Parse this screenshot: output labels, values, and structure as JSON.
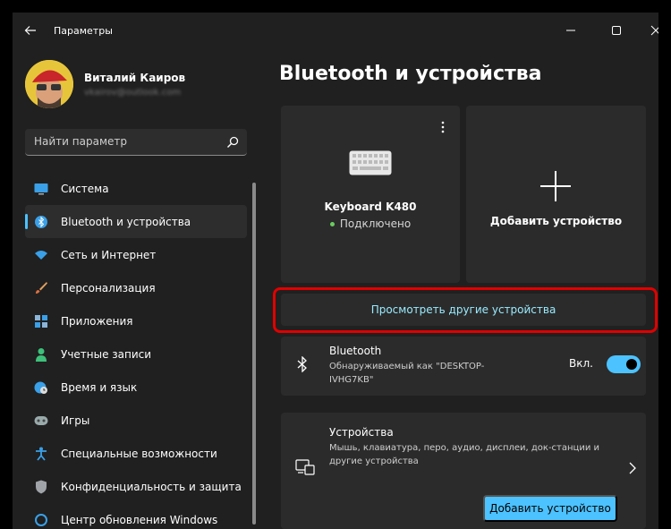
{
  "window": {
    "title": "Параметры"
  },
  "profile": {
    "name": "Виталий Каиров",
    "email": "vkairov@outlook.com"
  },
  "search": {
    "placeholder": "Найти параметр"
  },
  "sidebar": {
    "items": [
      {
        "label": "Система",
        "icon": "monitor-icon"
      },
      {
        "label": "Bluetooth и устройства",
        "icon": "bluetooth-icon",
        "active": true
      },
      {
        "label": "Сеть и Интернет",
        "icon": "wifi-icon"
      },
      {
        "label": "Персонализация",
        "icon": "brush-icon"
      },
      {
        "label": "Приложения",
        "icon": "apps-icon"
      },
      {
        "label": "Учетные записи",
        "icon": "person-icon"
      },
      {
        "label": "Время и язык",
        "icon": "globe-clock-icon"
      },
      {
        "label": "Игры",
        "icon": "gamepad-icon"
      },
      {
        "label": "Специальные возможности",
        "icon": "accessibility-icon"
      },
      {
        "label": "Конфиденциальность и защита",
        "icon": "shield-icon"
      },
      {
        "label": "Центр обновления Windows",
        "icon": "update-icon"
      }
    ]
  },
  "main": {
    "title": "Bluetooth и устройства",
    "device_card": {
      "name": "Keyboard K480",
      "status": "Подключено",
      "icon": "keyboard-icon"
    },
    "add_card": {
      "label": "Добавить устройство",
      "icon": "plus-icon"
    },
    "more_devices_label": "Просмотреть другие устройства",
    "bluetooth": {
      "title": "Bluetooth",
      "description": "Обнаруживаемый как \"DESKTOP-IVHG7KB\"",
      "state": "Вкл.",
      "enabled": true
    },
    "devices": {
      "title": "Устройства",
      "description": "Мышь, клавиатура, перо, аудио, дисплеи, док-станции и другие устройства",
      "button_label": "Добавить устройство"
    }
  },
  "colors": {
    "background": "#202020",
    "card": "#2b2b2b",
    "accent": "#4cc2ff",
    "link": "#99ebff",
    "connected": "#6ccb5f",
    "highlight": "#e10000"
  }
}
